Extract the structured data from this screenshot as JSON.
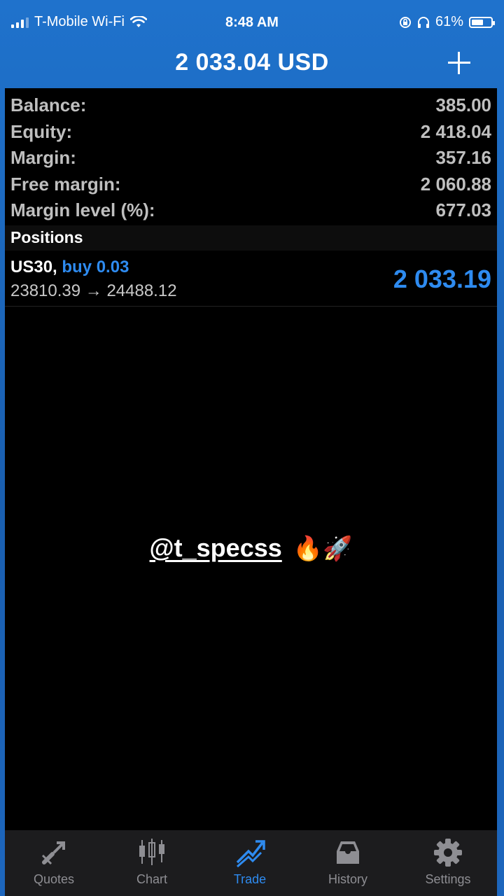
{
  "status_bar": {
    "carrier": "T-Mobile Wi-Fi",
    "time": "8:48 AM",
    "battery": "61%",
    "battery_level": 0.61
  },
  "header": {
    "title": "2 033.04 USD"
  },
  "account": {
    "rows": [
      {
        "label": "Balance:",
        "value": "385.00"
      },
      {
        "label": "Equity:",
        "value": "2 418.04"
      },
      {
        "label": "Margin:",
        "value": "357.16"
      },
      {
        "label": "Free margin:",
        "value": "2 060.88"
      },
      {
        "label": "Margin level (%):",
        "value": "677.03"
      }
    ]
  },
  "positions": {
    "header": "Positions",
    "items": [
      {
        "symbol": "US30,",
        "type": "buy 0.03",
        "prices": "23810.39 → 24488.12",
        "profit": "2 033.19"
      }
    ]
  },
  "overlay": {
    "handle": "@t_specss",
    "emojis": "🔥🚀"
  },
  "tab_bar": {
    "tabs": [
      {
        "label": "Quotes",
        "icon": "quotes-icon"
      },
      {
        "label": "Chart",
        "icon": "chart-icon"
      },
      {
        "label": "Trade",
        "icon": "trade-icon",
        "active": true
      },
      {
        "label": "History",
        "icon": "history-icon"
      },
      {
        "label": "Settings",
        "icon": "settings-icon"
      }
    ]
  },
  "colors": {
    "accent": "#2e8bf0",
    "header_bg": "#1f72cc",
    "tab_inactive": "#8e8e93"
  }
}
